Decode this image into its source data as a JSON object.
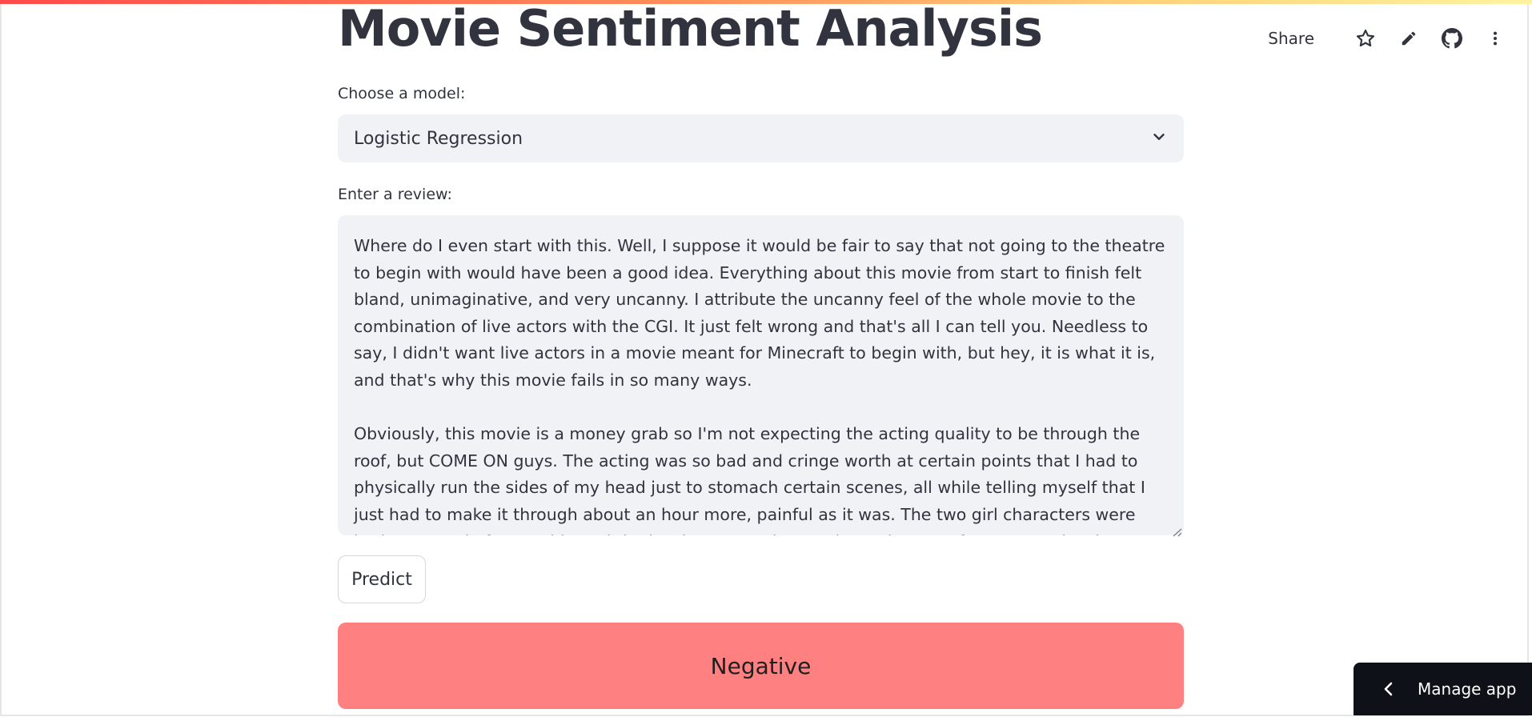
{
  "app": {
    "title": "Movie Sentiment Analysis"
  },
  "toolbar": {
    "share_label": "Share",
    "icons": [
      "star-icon",
      "pencil-icon",
      "github-icon",
      "more-vertical-icon"
    ]
  },
  "model_select": {
    "label": "Choose a model:",
    "selected": "Logistic Regression"
  },
  "review": {
    "label": "Enter a review:",
    "paragraphs": [
      "Where do I even start with this. Well, I suppose it would be fair to say that not going to the theatre to begin with would have been a good idea. Everything about this movie from start to finish felt bland, unimaginative, and very uncanny. I attribute the uncanny feel of the whole movie to the combination of live actors with the CGI. It just felt wrong and that's all I can tell you. Needless to say, I didn't want live actors in a movie meant for Minecraft to begin with, but hey, it is what it is, and that's why this movie fails in so many ways.",
      "Obviously, this movie is a money grab so I'm not expecting the acting quality to be through the roof, but COME ON guys. The acting was so bad and cringe worth at certain points that I had to physically run the sides of my head just to stomach certain scenes, all while telling myself that I just had to make it through about an hour more, painful as it was. The two girl characters were both extremely forgettable and the brother was uninteresting at best. As for Jason and Jack Black... Yeah. Not the"
    ]
  },
  "predict_button": {
    "label": "Predict"
  },
  "result": {
    "label": "Negative",
    "color": "#ff8080"
  },
  "manage_app": {
    "label": "Manage app"
  }
}
